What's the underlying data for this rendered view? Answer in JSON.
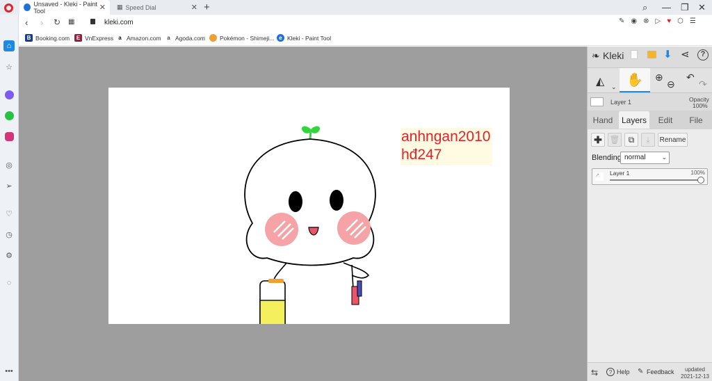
{
  "browser": {
    "tabs": [
      {
        "title": "Unsaved - Kleki - Paint Tool",
        "active": true
      },
      {
        "title": "Speed Dial",
        "active": false
      }
    ],
    "url": "kleki.com",
    "bookmarks": [
      "Booking.com",
      "VnExpress",
      "Amazon.com",
      "Agoda.com",
      "Pokémon - Shimeji...",
      "Kleki - Paint Tool"
    ]
  },
  "canvas": {
    "text_line1": "anhngan2010",
    "text_line2": "hđ247"
  },
  "kleki": {
    "logo": "Kleki",
    "layer_name": "Layer 1",
    "opacity_label": "Opacity",
    "opacity_value": "100%",
    "tabs": [
      "Hand",
      "Layers",
      "Edit",
      "File"
    ],
    "active_tab": "Layers",
    "rename_label": "Rename",
    "blending_label": "Blending",
    "blending_value": "normal",
    "layer_item_name": "Layer 1",
    "layer_item_opacity": "100%",
    "help_label": "Help",
    "feedback_label": "Feedback",
    "updated_label": "updated",
    "updated_date": "2021-12-13"
  },
  "colors": {
    "opera_red": "#e0232d",
    "accent_blue": "#1e88e5",
    "canvas_text": "#e0232d",
    "sprout_green": "#32d53c"
  }
}
